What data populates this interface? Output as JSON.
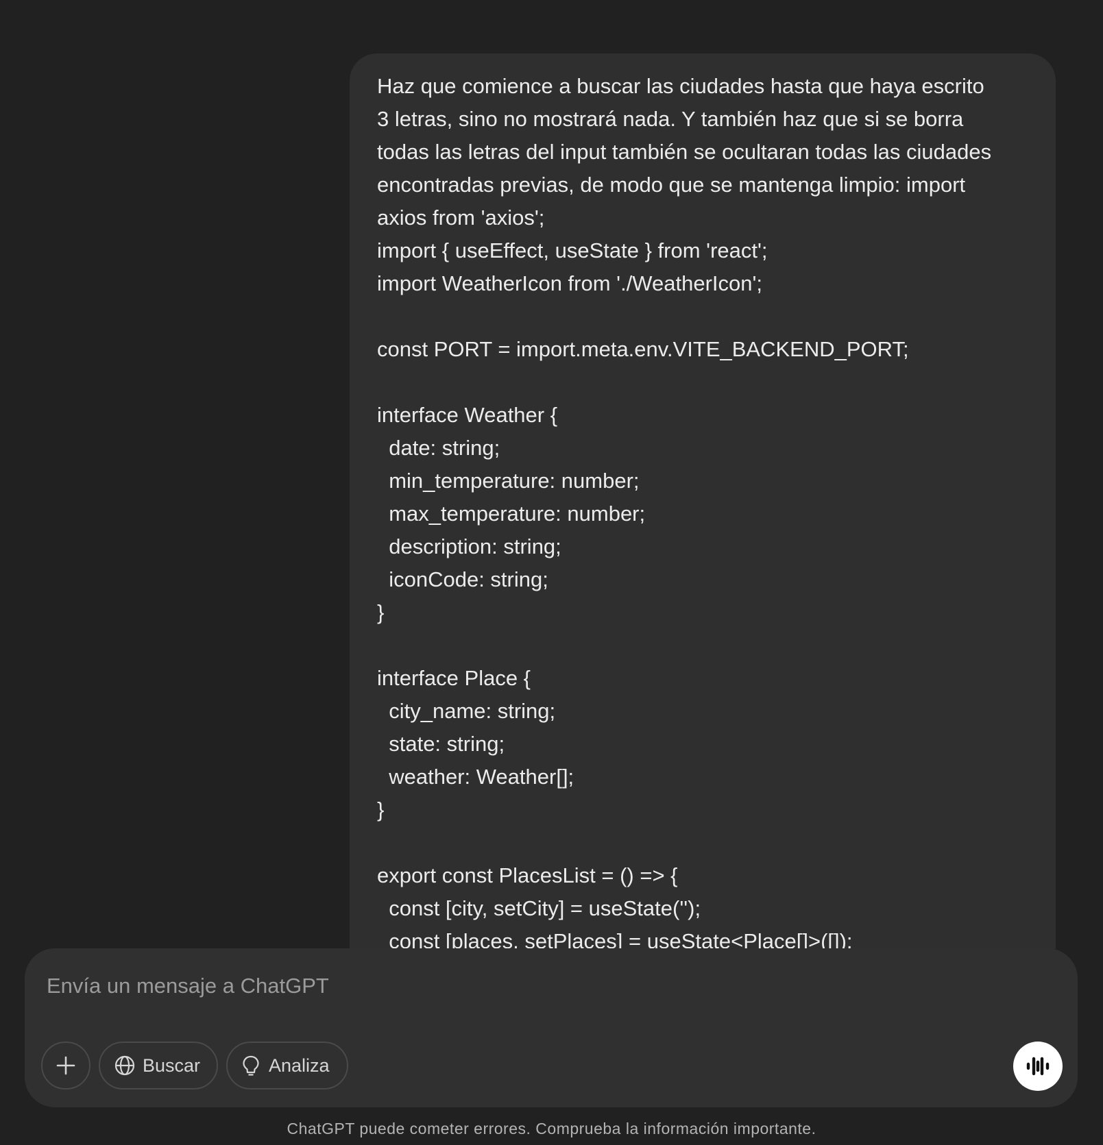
{
  "conversation": {
    "user_message_lines": [
      "Haz que comience a buscar las ciudades hasta que haya escrito",
      "3 letras, sino no mostrará nada. Y también haz que si se borra",
      "todas las letras del input también se ocultaran todas las ciudades",
      "encontradas previas, de modo que se mantenga limpio: import",
      "axios from 'axios';",
      "import { useEffect, useState } from 'react';",
      "import WeatherIcon from './WeatherIcon';",
      "",
      "const PORT = import.meta.env.VITE_BACKEND_PORT;",
      "",
      "interface Weather {",
      "  date: string;",
      "  min_temperature: number;",
      "  max_temperature: number;",
      "  description: string;",
      "  iconCode: string;",
      "}",
      "",
      "interface Place {",
      "  city_name: string;",
      "  state: string;",
      "  weather: Weather[];",
      "}",
      "",
      "export const PlacesList = () => {",
      "  const [city, setCity] = useState('');",
      "  const [places, setPlaces] = useState<Place[]>([]);"
    ]
  },
  "composer": {
    "placeholder": "Envía un mensaje a ChatGPT",
    "value": "",
    "add_icon": "plus-icon",
    "search_label": "Buscar",
    "search_icon": "globe-icon",
    "think_label": "Analiza",
    "think_icon": "lightbulb-icon",
    "voice_icon": "voice-waveform-icon"
  },
  "footer": {
    "disclaimer": "ChatGPT puede cometer errores. Comprueba la información importante."
  },
  "colors": {
    "background": "#212121",
    "bubble": "#2f2f2f",
    "composer": "#303030",
    "text": "#ececec",
    "placeholder": "#9b9b9b"
  }
}
